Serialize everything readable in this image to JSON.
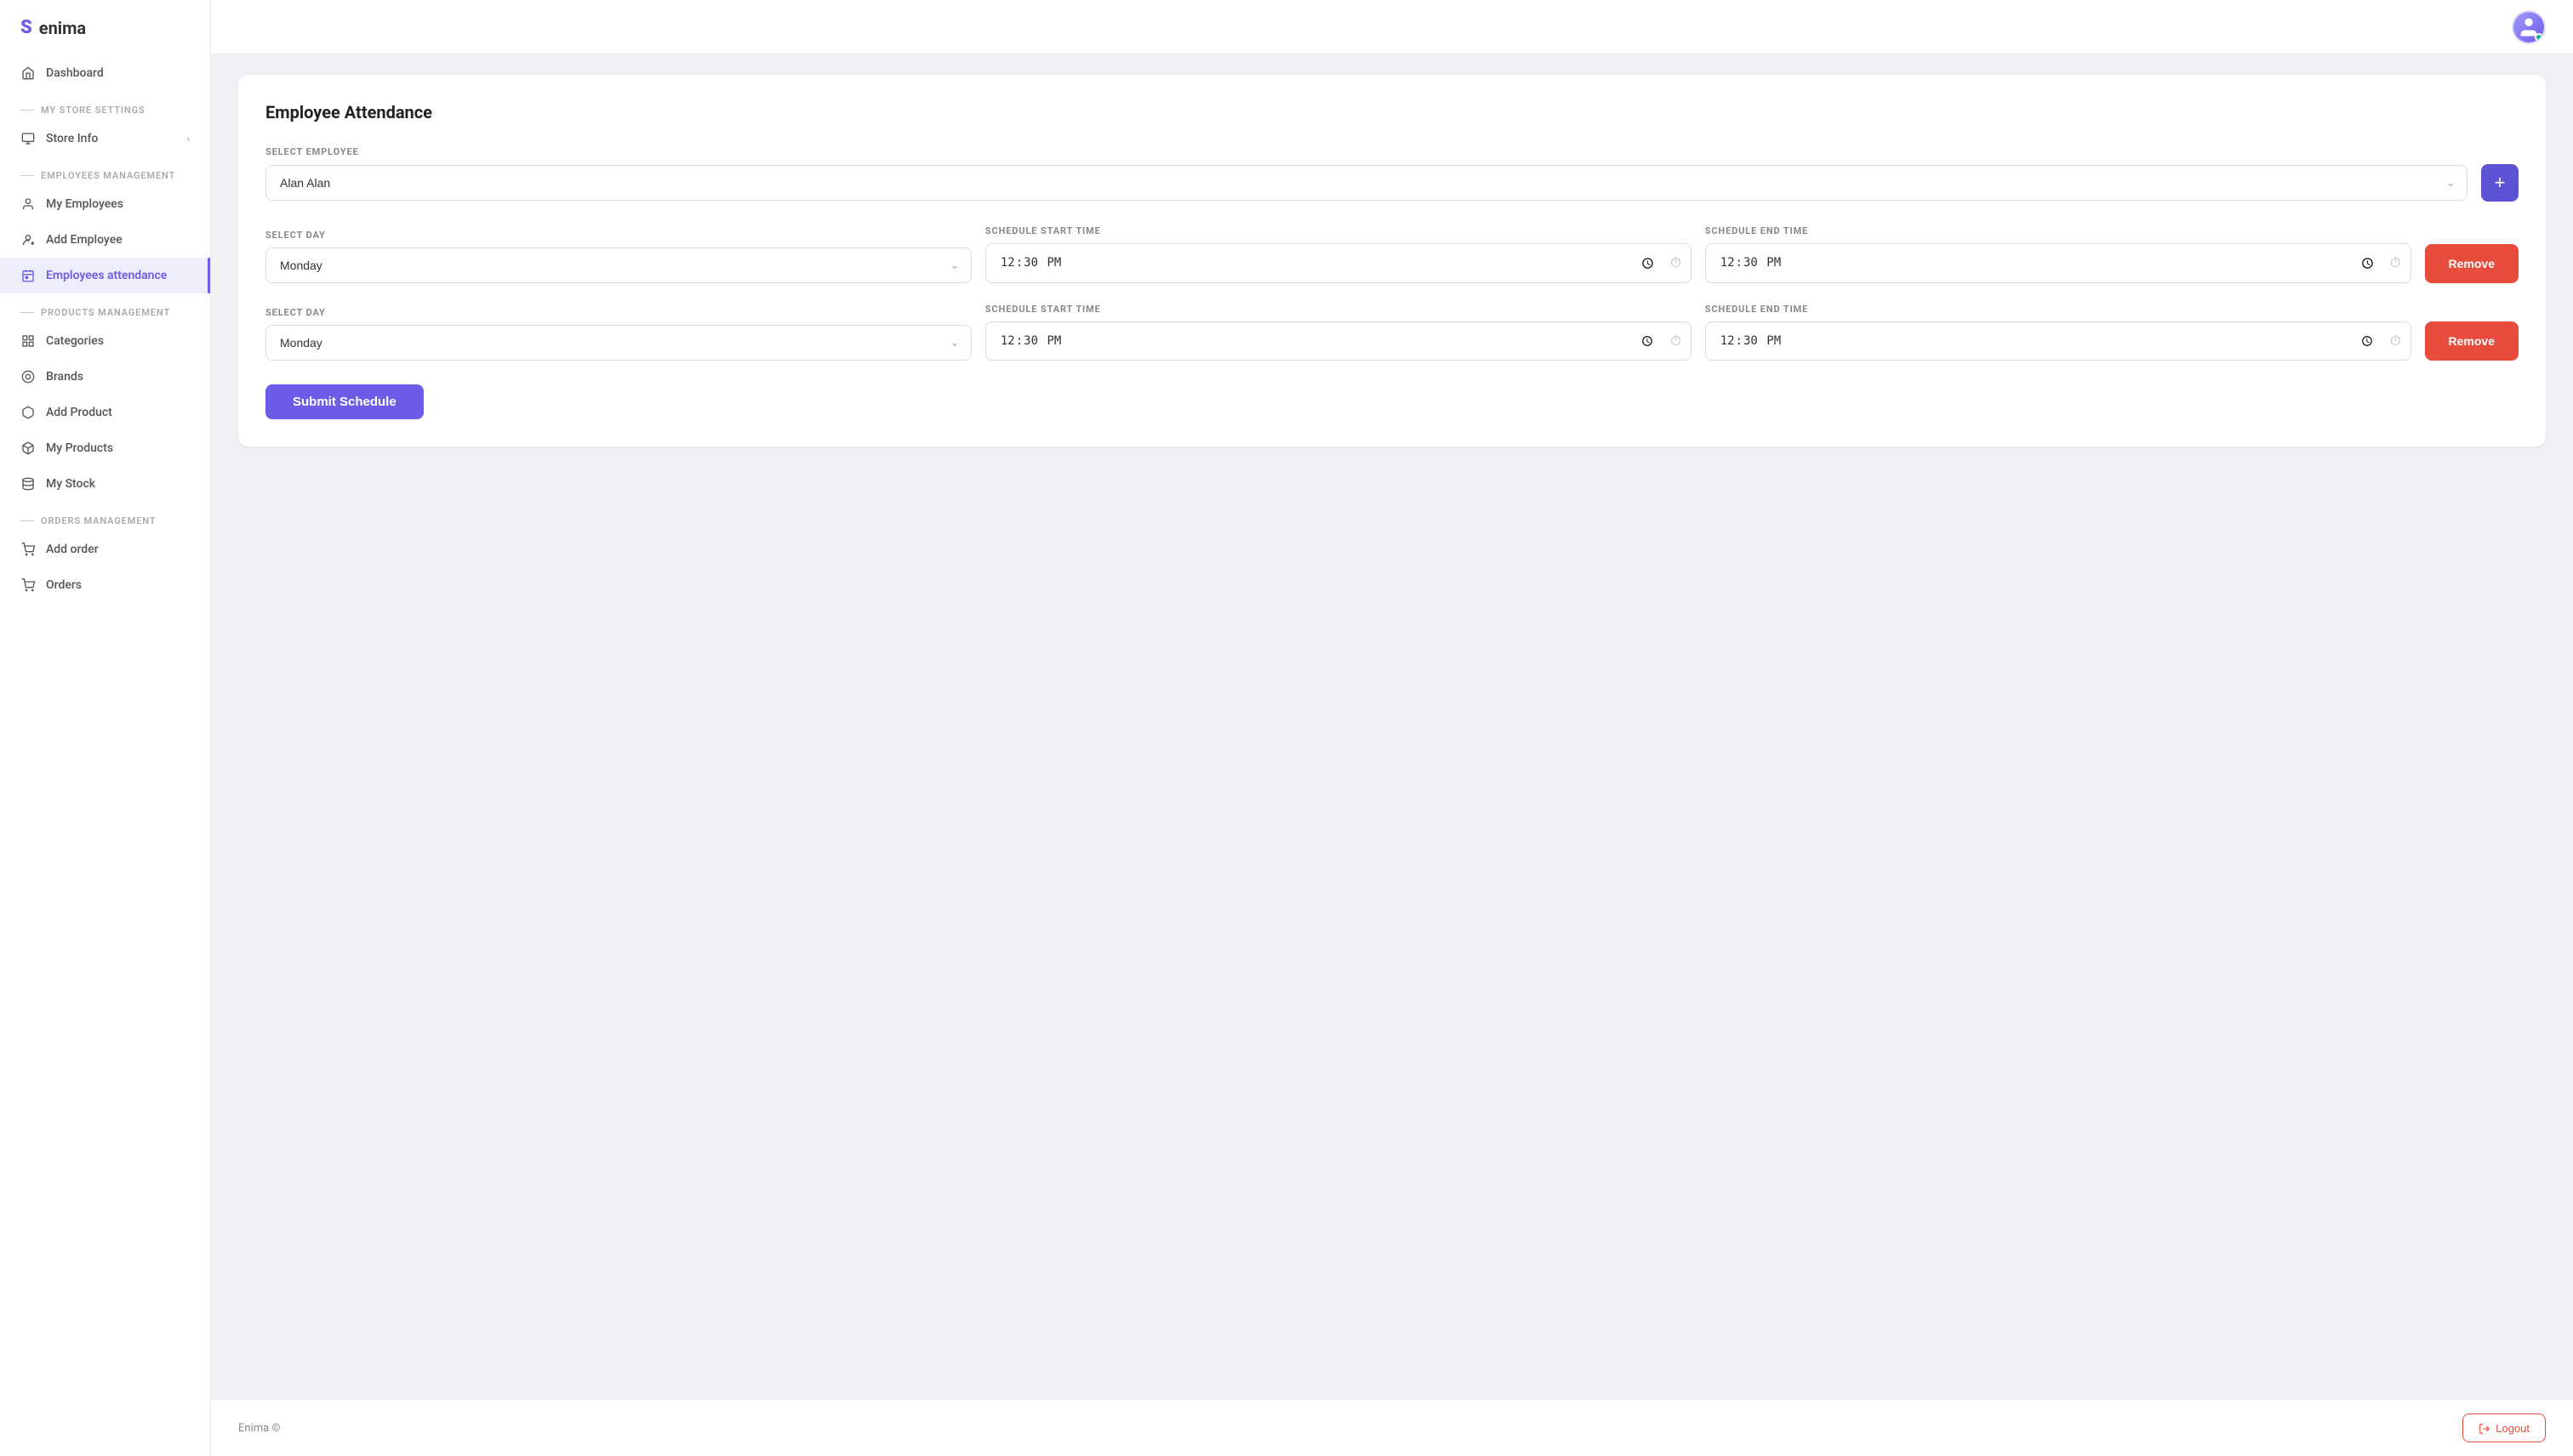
{
  "app": {
    "name": "enima",
    "logo_symbol": "S"
  },
  "sidebar": {
    "dashboard_label": "Dashboard",
    "sections": [
      {
        "id": "store-settings",
        "label": "MY STORE SETTINGS",
        "items": [
          {
            "id": "store-info",
            "label": "Store Info",
            "has_chevron": true
          }
        ]
      },
      {
        "id": "employees-management",
        "label": "EMPLOYEES MANAGEMENT",
        "items": [
          {
            "id": "my-employees",
            "label": "My Employees",
            "has_chevron": false
          },
          {
            "id": "add-employee",
            "label": "Add Employee",
            "has_chevron": false
          },
          {
            "id": "employees-attendance",
            "label": "Employees attendance",
            "has_chevron": false,
            "active": true
          }
        ]
      },
      {
        "id": "products-management",
        "label": "PRODUCTS MANAGEMENT",
        "items": [
          {
            "id": "categories",
            "label": "Categories",
            "has_chevron": false
          },
          {
            "id": "brands",
            "label": "Brands",
            "has_chevron": false
          },
          {
            "id": "add-product",
            "label": "Add Product",
            "has_chevron": false
          },
          {
            "id": "my-products",
            "label": "My Products",
            "has_chevron": false
          },
          {
            "id": "my-stock",
            "label": "My Stock",
            "has_chevron": false
          }
        ]
      },
      {
        "id": "orders-management",
        "label": "ORDERS MANAGEMENT",
        "items": [
          {
            "id": "add-order",
            "label": "Add order",
            "has_chevron": false
          },
          {
            "id": "orders",
            "label": "Orders",
            "has_chevron": false
          }
        ]
      }
    ]
  },
  "main": {
    "title": "Employee Attendance",
    "select_employee_label": "SELECT EMPLOYEE",
    "select_employee_value": "Alan Alan",
    "add_row_label": "+",
    "schedule_rows": [
      {
        "select_day_label": "SELECT DAY",
        "day_value": "Monday",
        "start_time_label": "SCHEDULE START TIME",
        "start_time_value": "12:30",
        "end_time_label": "SCHEDULE END TIME",
        "end_time_value": "12:30",
        "remove_label": "Remove"
      },
      {
        "select_day_label": "SELECT DAY",
        "day_value": "Monday",
        "start_time_label": "SCHEDULE START TIME",
        "start_time_value": "12:30",
        "end_time_label": "SCHEDULE END TIME",
        "end_time_value": "12:30",
        "remove_label": "Remove"
      }
    ],
    "submit_label": "Submit Schedule"
  },
  "footer": {
    "copyright": "Enima ©",
    "logout_label": "Logout"
  },
  "colors": {
    "primary": "#6c5ce7",
    "danger": "#e74c3c",
    "success": "#00b894"
  }
}
